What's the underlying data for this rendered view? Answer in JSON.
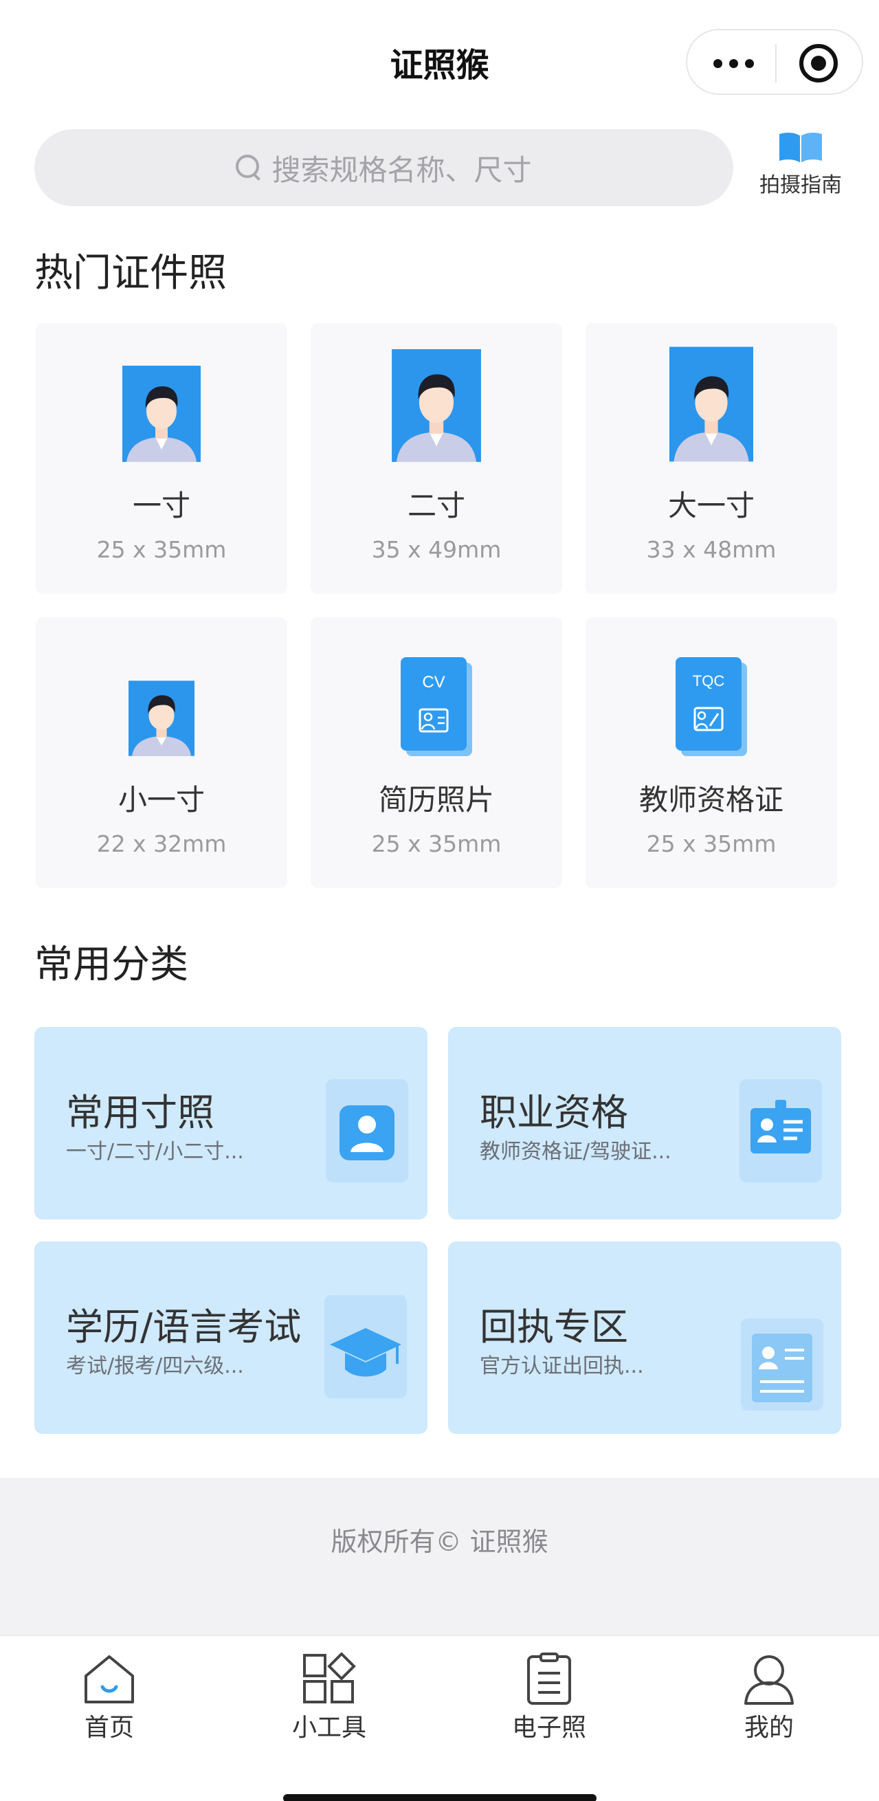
{
  "app": {
    "title": "证照猴"
  },
  "search": {
    "placeholder": "搜索规格名称、尺寸"
  },
  "guide": {
    "label": "拍摄指南"
  },
  "hot_section": {
    "title": "热门证件照"
  },
  "hot_items": [
    {
      "name": "一寸",
      "size": "25 x 35mm"
    },
    {
      "name": "二寸",
      "size": "35 x 49mm"
    },
    {
      "name": "大一寸",
      "size": "33 x 48mm"
    },
    {
      "name": "小一寸",
      "size": "22 x 32mm"
    },
    {
      "name": "简历照片",
      "size": "25 x 35mm",
      "icon_text": "CV"
    },
    {
      "name": "教师资格证",
      "size": "25 x 35mm",
      "icon_text": "TQC"
    }
  ],
  "category_section": {
    "title": "常用分类"
  },
  "categories": [
    {
      "title": "常用寸照",
      "subtitle": "一寸/二寸/小二寸..."
    },
    {
      "title": "职业资格",
      "subtitle": "教师资格证/驾驶证..."
    },
    {
      "title": "学历/语言考试",
      "subtitle": "考试/报考/四六级..."
    },
    {
      "title": "回执专区",
      "subtitle": "官方认证出回执..."
    }
  ],
  "footer": {
    "copyright": "版权所有© 证照猴"
  },
  "tabbar": [
    {
      "label": "首页"
    },
    {
      "label": "小工具"
    },
    {
      "label": "电子照"
    },
    {
      "label": "我的"
    }
  ],
  "colors": {
    "accent": "#2f9bf0",
    "photo_bg": "#2c96ec",
    "category_bg": "#cfe9fd"
  }
}
